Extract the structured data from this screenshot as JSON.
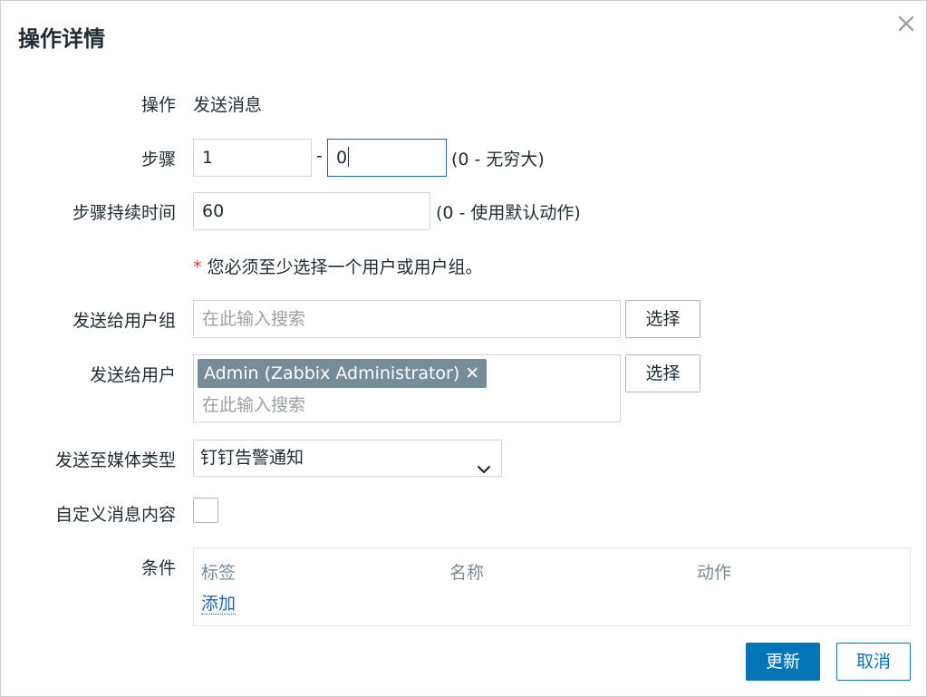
{
  "dialog": {
    "title": "操作详情",
    "close_icon": "close-icon"
  },
  "form": {
    "operation": {
      "label": "操作",
      "value": "发送消息"
    },
    "steps": {
      "label": "步骤",
      "from": "1",
      "separator": "-",
      "to": "0",
      "hint": "(0 - 无穷大)"
    },
    "step_duration": {
      "label": "步骤持续时间",
      "value": "60",
      "hint": "(0 - 使用默认动作)"
    },
    "required_notice": {
      "mark": "*",
      "text": "您必须至少选择一个用户或用户组。"
    },
    "user_groups": {
      "label": "发送给用户组",
      "placeholder": "在此输入搜索",
      "select_label": "选择"
    },
    "users": {
      "label": "发送给用户",
      "chips": [
        "Admin (Zabbix Administrator)"
      ],
      "chip_remove_glyph": "✕",
      "placeholder": "在此输入搜索",
      "select_label": "选择"
    },
    "media_type": {
      "label": "发送至媒体类型",
      "selected": "钉钉告警通知"
    },
    "custom_message": {
      "label": "自定义消息内容",
      "checked": false
    },
    "conditions": {
      "label": "条件",
      "columns": [
        "标签",
        "名称",
        "动作"
      ],
      "add_label": "添加"
    }
  },
  "footer": {
    "update_label": "更新",
    "cancel_label": "取消"
  },
  "colors": {
    "primary": "#0275b8",
    "chip_bg": "#768d99",
    "required": "#e53935",
    "link": "#1f65b0"
  }
}
